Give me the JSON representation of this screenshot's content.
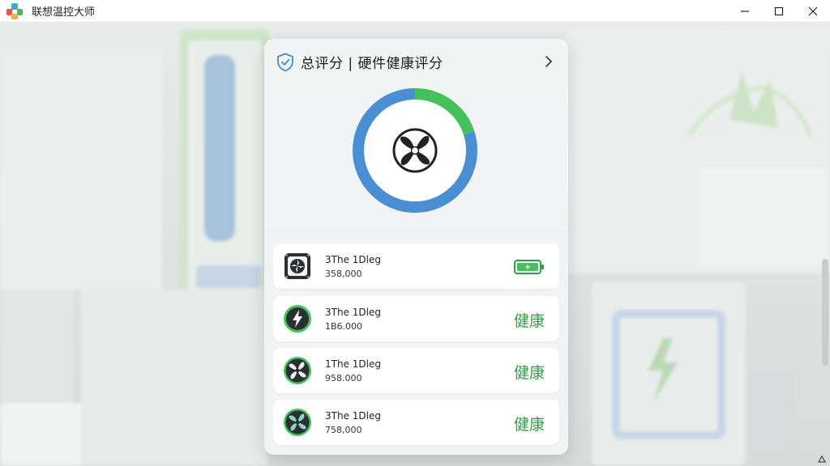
{
  "window": {
    "title": "联想温控大师"
  },
  "card": {
    "title": "总评分 | 硬件健康评分"
  },
  "score_ring": {
    "segments": [
      {
        "color": "#4a8fd4",
        "fraction": 0.8
      },
      {
        "color": "#43c15a",
        "fraction": 0.2
      }
    ]
  },
  "rows": [
    {
      "name": "3The 1Dleg",
      "value": "358,000",
      "status": "",
      "icon": "fan-chip-icon",
      "indicator": "battery-icon"
    },
    {
      "name": "3The 1Dleg",
      "value": "1B6.000",
      "status": "健康",
      "icon": "lightning-icon"
    },
    {
      "name": "1The 1Dleg",
      "value": "958.000",
      "status": "健康",
      "icon": "fan-icon"
    },
    {
      "name": "3The 1Dleg",
      "value": "758,000",
      "status": "健康",
      "icon": "fan-teal-icon"
    }
  ],
  "colors": {
    "accent_green": "#2f9e44",
    "accent_blue": "#4a8fd4"
  }
}
